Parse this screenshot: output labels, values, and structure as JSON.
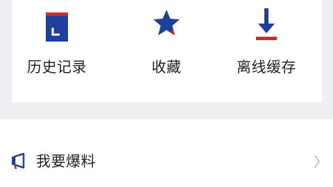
{
  "colors": {
    "accent_blue": "#1e3f9a",
    "accent_red": "#d12a2a",
    "background": "#eeeff3"
  },
  "shortcuts": [
    {
      "label": "历史记录",
      "icon": "history-icon"
    },
    {
      "label": "收藏",
      "icon": "star-icon"
    },
    {
      "label": "离线缓存",
      "icon": "download-icon"
    }
  ],
  "menu": {
    "items": [
      {
        "label": "我要爆料",
        "icon": "megaphone-icon"
      }
    ]
  }
}
